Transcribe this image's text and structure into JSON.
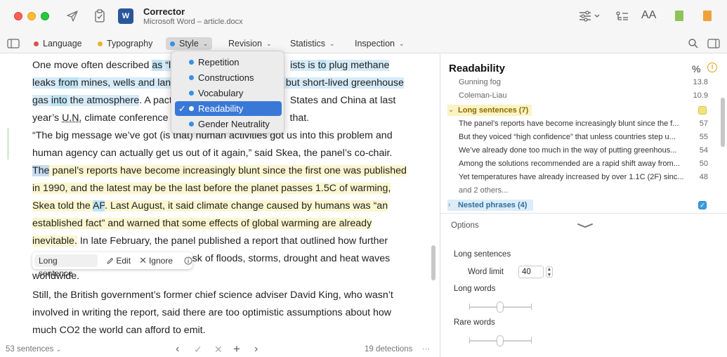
{
  "app": {
    "title": "Corrector",
    "subtitle": "Microsoft Word – article.docx",
    "word_icon": "W",
    "text_size_label": "AA"
  },
  "tabs": [
    {
      "label": "Language",
      "color": "#d9534f"
    },
    {
      "label": "Typography",
      "color": "#e6b52a"
    },
    {
      "label": "Style",
      "color": "#3a8ee6",
      "active": true
    },
    {
      "label": "Revision"
    },
    {
      "label": "Statistics"
    },
    {
      "label": "Inspection"
    }
  ],
  "style_menu": {
    "items": [
      "Repetition",
      "Constructions",
      "Vocabulary",
      "Readability",
      "Gender Neutrality"
    ],
    "selected": "Readability"
  },
  "doc": {
    "l1": [
      "One move often described ",
      "as",
      " “l",
      "ists is ",
      "to",
      " plug methane"
    ],
    "l2": [
      "leaks ",
      "from",
      " mines, wells and land",
      "t but short-lived greenhouse"
    ],
    "l3": [
      "gas ",
      "into",
      " the atmosphere",
      ". A pact",
      " States and China at last"
    ],
    "l4": [
      "year’s ",
      "U.N.",
      " climate conference i",
      " that."
    ],
    "l5": [
      "“The big message we’ve got (is that) human activities got us into this problem and"
    ],
    "l6": [
      "human agency can actually get us out of it again,” said Skea, the panel’s co-chair."
    ],
    "l7": [
      "The",
      " panel’s reports have become increasingly blunt since the first one was published"
    ],
    "l8": [
      "in 1990, and the latest may be the last before the planet passes 1.5C of warming,"
    ],
    "l9": [
      "Skea told the ",
      "AP",
      ". Last August, it said climate change caused by humans was “an"
    ],
    "l10": [
      "established fact” and warned that some effects of global warming are already"
    ],
    "l11": [
      "inevitable.",
      " In late February, the panel published a report that outlined how further"
    ],
    "l12": [
      "e risk of floods, storms, drought and heat waves"
    ],
    "l13": [
      "worldwide."
    ],
    "l14": [
      "Still, the British government’s former chief science adviser David King, who wasn’t"
    ],
    "l15": [
      "involved in writing the report, said there are too optimistic assumptions about how"
    ],
    "l16": [
      "much CO2 the world can afford to emit."
    ]
  },
  "popup": {
    "label": "Long sentence",
    "edit": "Edit",
    "ignore": "Ignore"
  },
  "status": {
    "sentences": "53 sentences",
    "detections": "19 detections",
    "more": "···"
  },
  "panel": {
    "title": "Readability",
    "percent": "%",
    "scores": [
      {
        "name": "Gunning fog",
        "value": "13.8"
      },
      {
        "name": "Coleman-Liau",
        "value": "10.9"
      }
    ],
    "long_sentences": {
      "header": "Long sentences (7)",
      "items": [
        {
          "text": "The panel’s reports have become increasingly blunt since the f...",
          "value": "57"
        },
        {
          "text": "But they voiced “high confidence” that unless countries step u...",
          "value": "55"
        },
        {
          "text": "We’ve already done too much in the way of putting greenhous...",
          "value": "54"
        },
        {
          "text": "Among the solutions recommended are a rapid shift away from...",
          "value": "50"
        },
        {
          "text": "Yet temperatures have already increased by over 1.1C (2F) sinc...",
          "value": "48"
        }
      ],
      "more": "and 2 others..."
    },
    "nested_phrases": {
      "header": "Nested phrases (4)"
    },
    "options": {
      "title": "Options",
      "long_sentences": "Long sentences",
      "word_limit_label": "Word limit",
      "word_limit_value": "40",
      "long_words": "Long words",
      "rare_words": "Rare words"
    }
  }
}
